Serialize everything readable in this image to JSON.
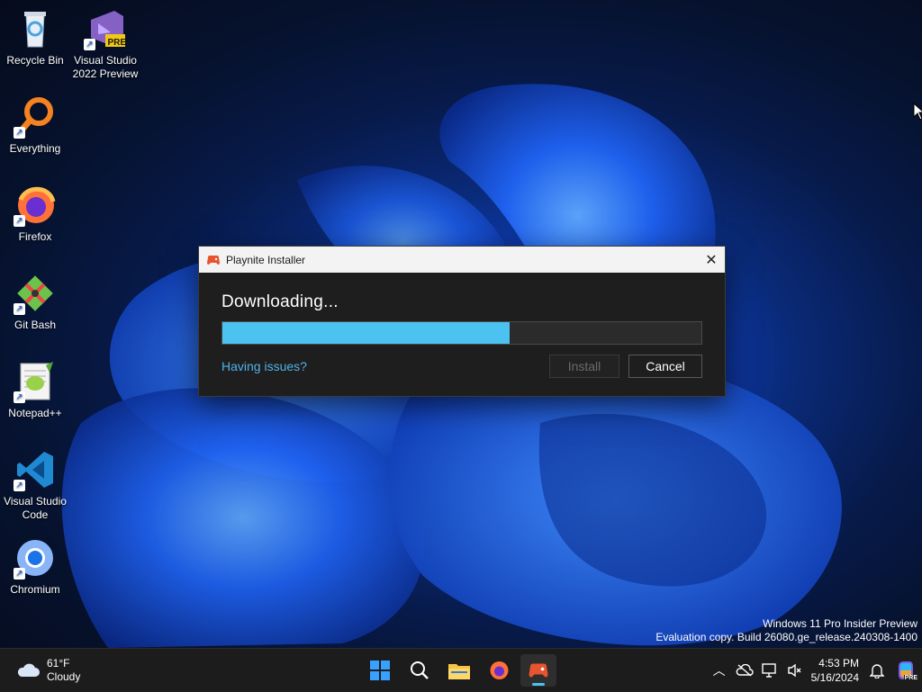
{
  "desktop": {
    "icons": [
      {
        "label": "Recycle Bin"
      },
      {
        "label": "Visual Studio 2022 Preview",
        "badge": "PRE"
      },
      {
        "label": "Everything"
      },
      {
        "label": "Firefox"
      },
      {
        "label": "Git Bash"
      },
      {
        "label": "Notepad++"
      },
      {
        "label": "Visual Studio Code"
      },
      {
        "label": "Chromium"
      }
    ]
  },
  "installer": {
    "title": "Playnite Installer",
    "heading": "Downloading...",
    "progress": 0.6,
    "link": "Having issues?",
    "install_label": "Install",
    "cancel_label": "Cancel",
    "accent_color": "#4cc2f1"
  },
  "watermark": {
    "line1": "Windows 11 Pro Insider Preview",
    "line2": "Evaluation copy. Build 26080.ge_release.240308-1400"
  },
  "taskbar": {
    "weather": {
      "temp": "61°F",
      "condition": "Cloudy"
    },
    "apps": [
      "windows-start-icon",
      "search-icon",
      "file-explorer-icon",
      "firefox-icon",
      "playnite-icon"
    ],
    "clock": {
      "time": "4:53 PM",
      "date": "5/16/2024"
    },
    "copilot_badge": "PRE"
  }
}
